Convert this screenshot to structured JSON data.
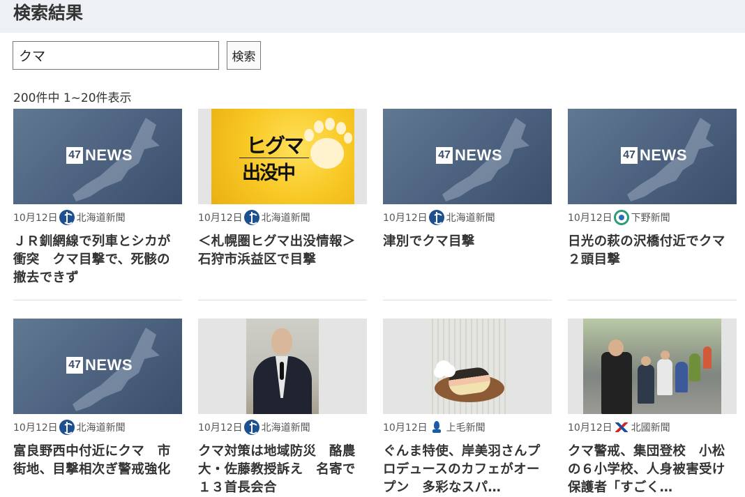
{
  "header": {
    "title": "検索結果"
  },
  "search": {
    "value": "クマ",
    "button_label": "検索"
  },
  "results": {
    "count_text": "200件中 1~20件表示"
  },
  "brand": {
    "badge_number": "47",
    "wordmark": "NEWS"
  },
  "higuma_image": {
    "line1": "ヒグマ",
    "line2": "出没中"
  },
  "cards": [
    {
      "date": "10月12日",
      "source": "北海道新聞",
      "source_icon": "hokkaido-shimbun-logo-icon",
      "title": "ＪＲ釧網線で列車とシカが衝突　クマ目撃で、死骸の撤去できず",
      "image": "47news-placeholder"
    },
    {
      "date": "10月12日",
      "source": "北海道新聞",
      "source_icon": "hokkaido-shimbun-logo-icon",
      "title": "＜札幌圏ヒグマ出没情報＞石狩市浜益区で目撃",
      "image": "higuma-alert"
    },
    {
      "date": "10月12日",
      "source": "北海道新聞",
      "source_icon": "hokkaido-shimbun-logo-icon",
      "title": "津別でクマ目撃",
      "image": "47news-placeholder"
    },
    {
      "date": "10月12日",
      "source": "下野新聞",
      "source_icon": "shimotsuke-shimbun-logo-icon",
      "title": "日光の萩の沢橋付近でクマ２頭目撃",
      "image": "47news-placeholder"
    },
    {
      "date": "10月12日",
      "source": "北海道新聞",
      "source_icon": "hokkaido-shimbun-logo-icon",
      "title": "富良野西中付近にクマ　市街地、目撃相次ぎ警戒強化",
      "image": "47news-placeholder"
    },
    {
      "date": "10月12日",
      "source": "北海道新聞",
      "source_icon": "hokkaido-shimbun-logo-icon",
      "title": "クマ対策は地域防災　酪農大・佐藤教授訴え　名寄で１３首長会合",
      "image": "speaker-photo"
    },
    {
      "date": "10月12日",
      "source": "上毛新聞",
      "source_icon": "jomo-shimbun-logo-icon",
      "title": "ぐんま特使、岸美羽さんプロデュースのカフェがオープン　多彩なスパ…",
      "image": "food-photo"
    },
    {
      "date": "10月12日",
      "source": "北國新聞",
      "source_icon": "hokkoku-shimbun-logo-icon",
      "title": "クマ警戒、集団登校　小松の６小学校、人身被害受け　保護者「すごく…",
      "image": "kids-photo"
    }
  ],
  "colors": {
    "header_bg": "#edf1f6",
    "news47_bg": "#4f6582",
    "text": "#333333"
  }
}
